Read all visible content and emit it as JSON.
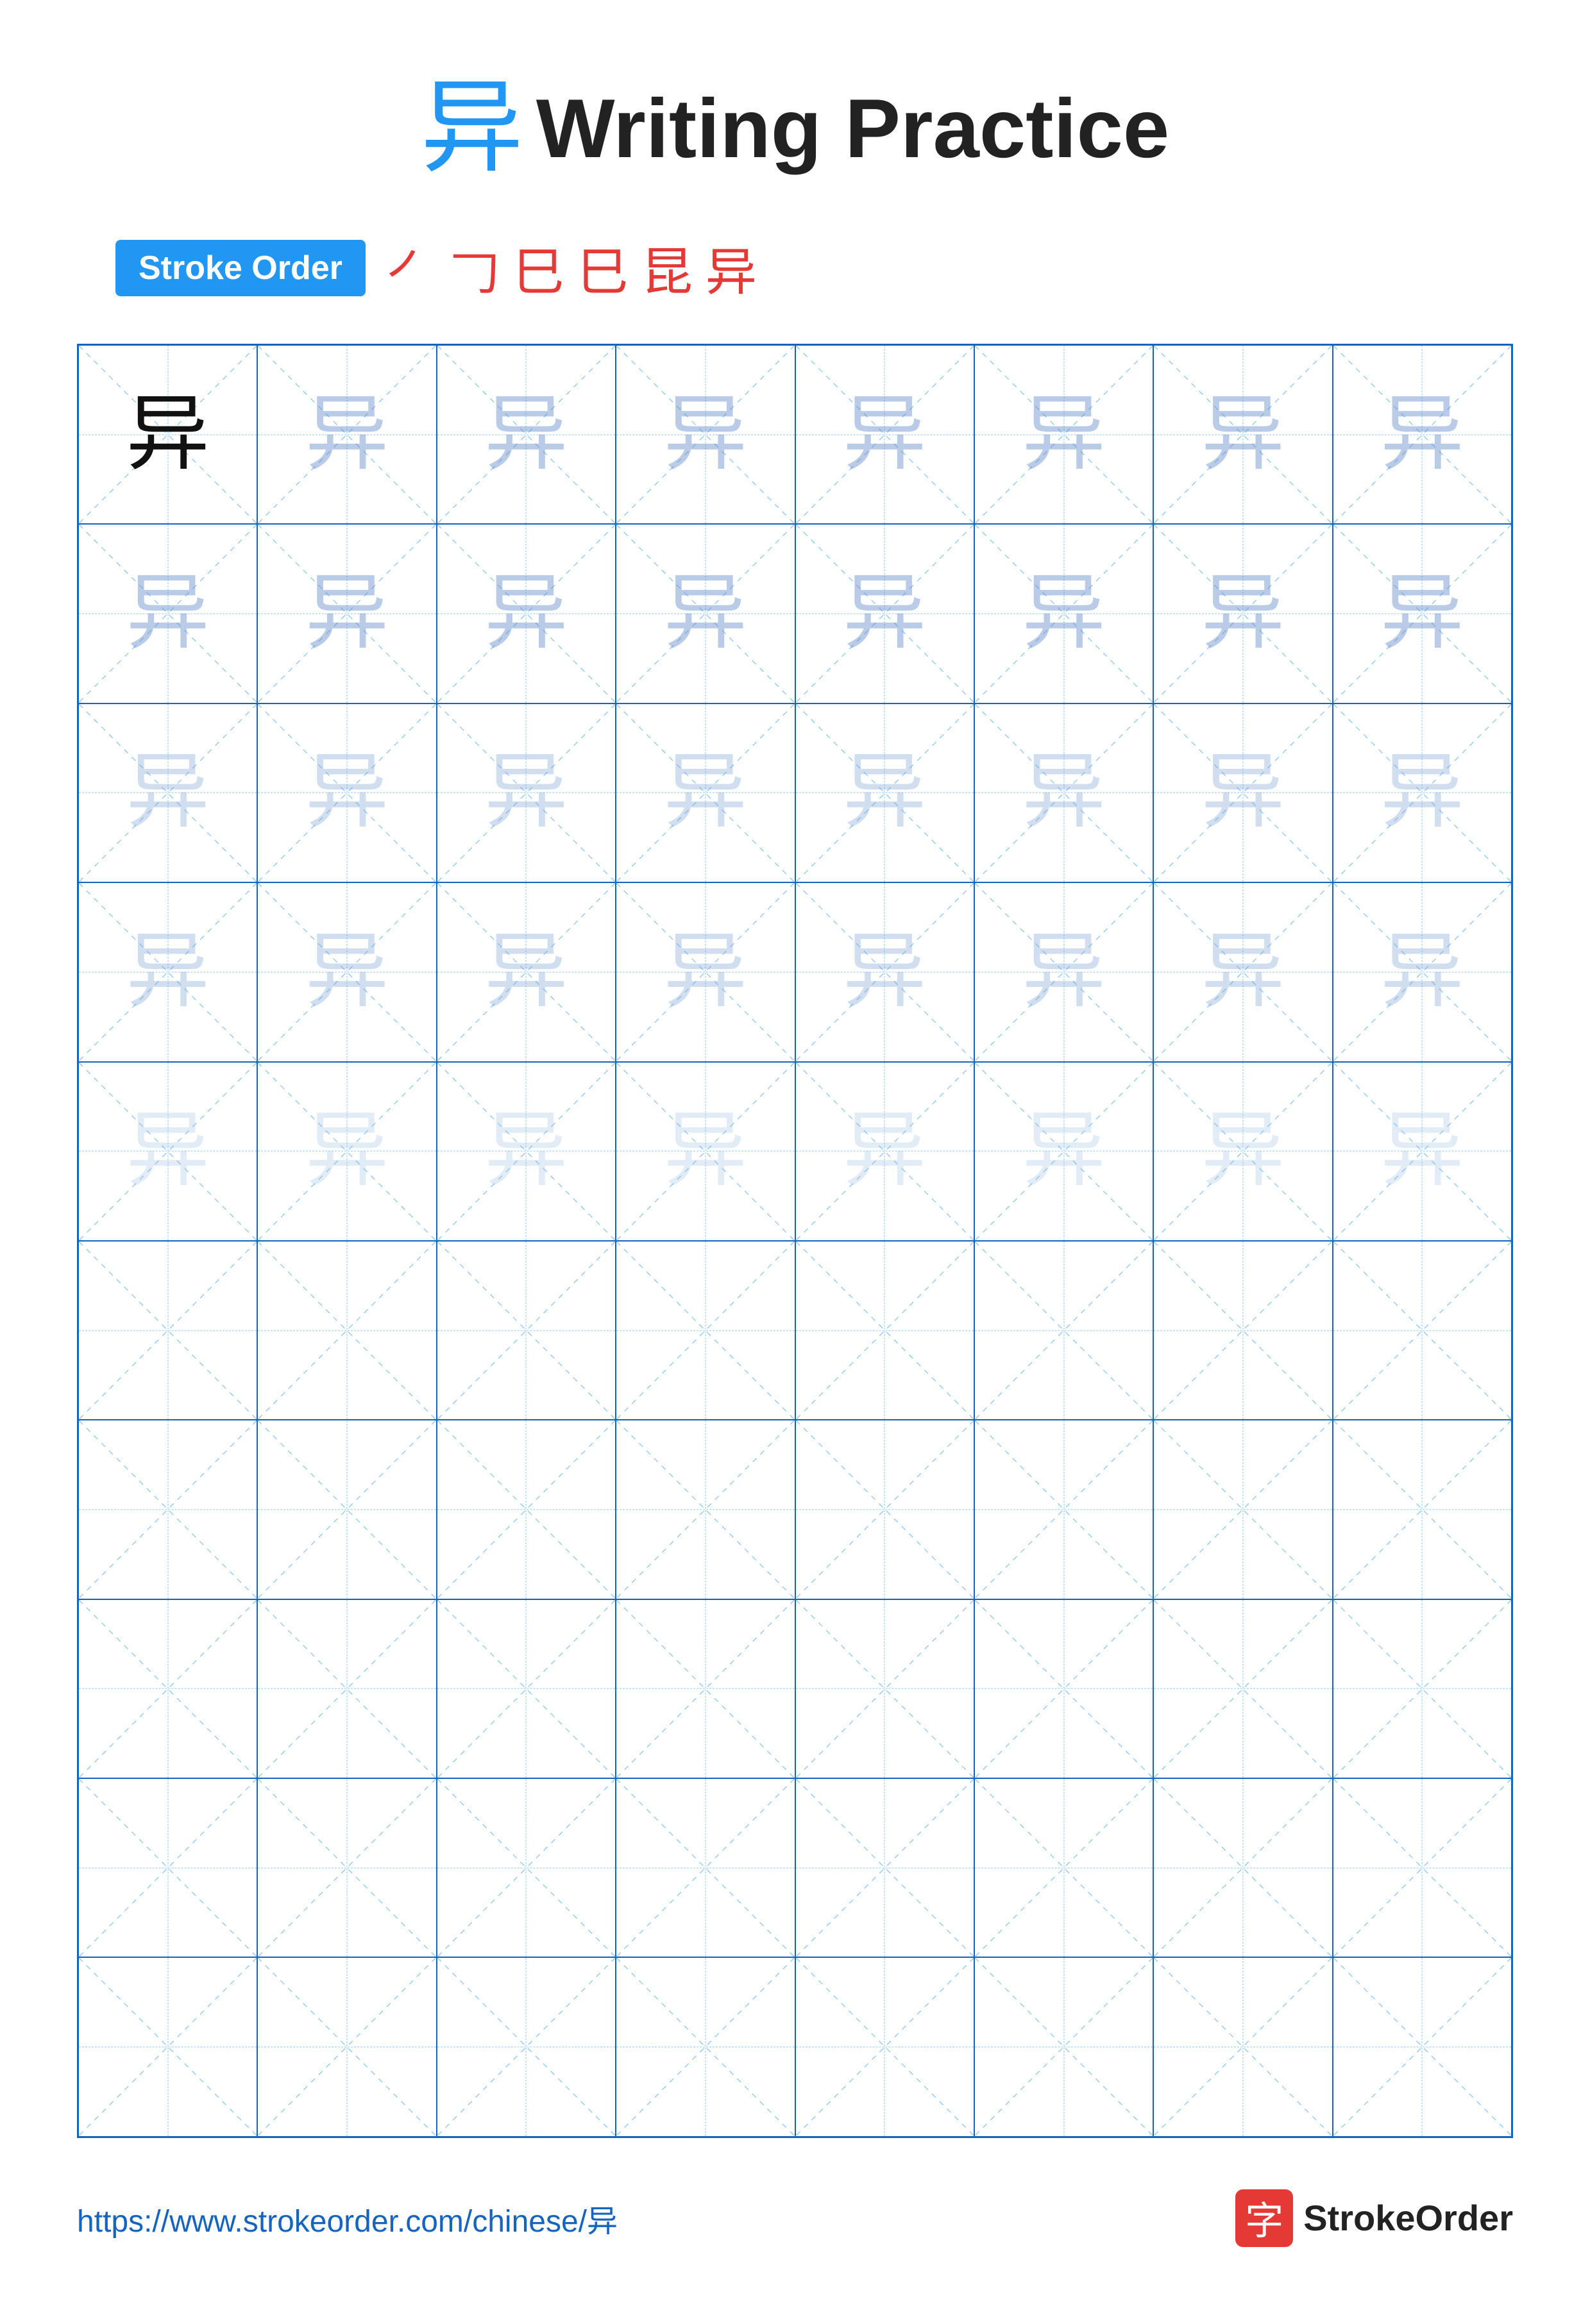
{
  "title": {
    "char": "异",
    "text": "Writing Practice"
  },
  "stroke_order": {
    "badge_label": "Stroke Order",
    "steps": [
      "㇒",
      "㇓",
      "巳",
      "巳",
      "昆",
      "异"
    ]
  },
  "grid": {
    "cols": 8,
    "rows": 10,
    "char": "异",
    "ghost_rows": 5,
    "empty_rows": 5
  },
  "footer": {
    "url": "https://www.strokeorder.com/chinese/异",
    "brand_icon": "字",
    "brand_name": "StrokeOrder"
  }
}
